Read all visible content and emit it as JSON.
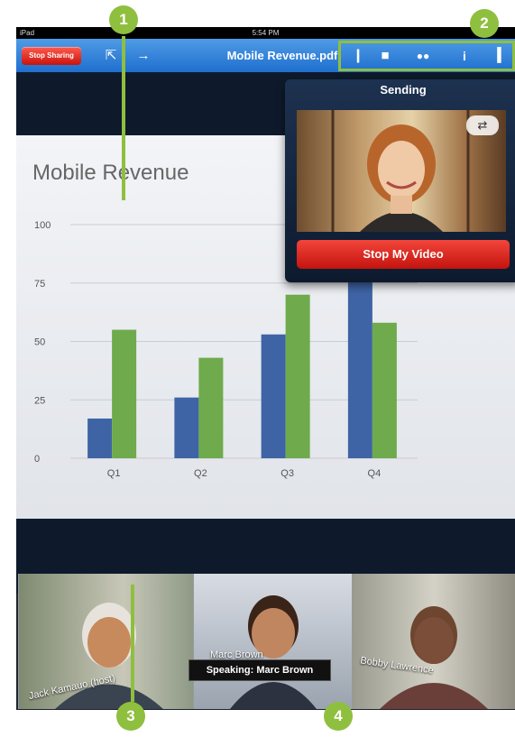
{
  "status": {
    "carrier": "iPad",
    "time": "5:54 PM"
  },
  "toolbar": {
    "stop_sharing": "Stop Sharing",
    "title": "Mobile Revenue.pdf",
    "icons": [
      "share-icon",
      "pointer-icon",
      "microphone-icon",
      "video-camera-icon",
      "participants-icon",
      "info-icon",
      "exit-icon"
    ]
  },
  "chart_data": {
    "type": "bar",
    "title": "Mobile Revenue",
    "categories": [
      "Q1",
      "Q2",
      "Q3",
      "Q4"
    ],
    "series": [
      {
        "values": [
          17,
          26,
          53,
          88
        ],
        "color": "#3f64a5"
      },
      {
        "values": [
          55,
          43,
          70,
          58
        ],
        "color": "#6faa4d"
      }
    ],
    "ylim": [
      0,
      100
    ],
    "yticks": [
      0,
      25,
      50,
      75,
      100
    ],
    "grid": true
  },
  "popover": {
    "title": "Sending",
    "stop_video": "Stop My Video",
    "camera_switch_icon": "camera-switch-icon"
  },
  "participants": [
    {
      "name": "Jack Kamauo (host)"
    },
    {
      "name": "Marc Brown"
    },
    {
      "name": "Bobby Lawrence"
    }
  ],
  "speaking": "Speaking: Marc Brown",
  "callouts": [
    "1",
    "2",
    "3",
    "4"
  ],
  "colors": {
    "accent": "#8fbf3f",
    "toolbar": "#2f80dc",
    "stop": "#d62a22"
  }
}
